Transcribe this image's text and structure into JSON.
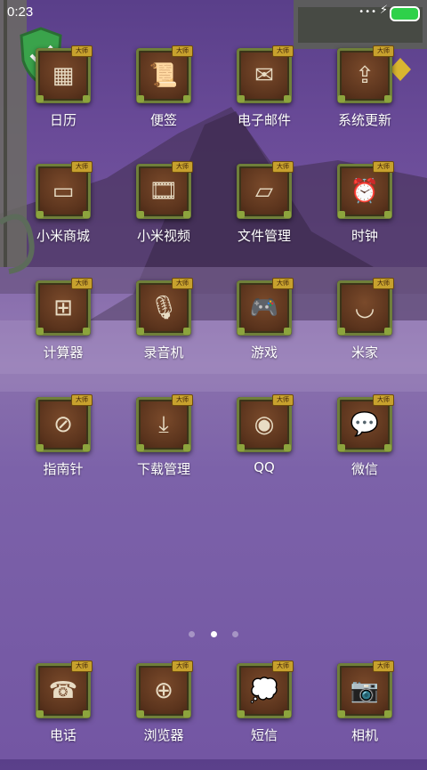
{
  "status_bar": {
    "time": "0:23",
    "signal": "•••"
  },
  "apps": [
    {
      "label": "日历",
      "glyph": "▦"
    },
    {
      "label": "便签",
      "glyph": "📜"
    },
    {
      "label": "电子邮件",
      "glyph": "✉"
    },
    {
      "label": "系统更新",
      "glyph": "⇪"
    },
    {
      "label": "小米商城",
      "glyph": "▭"
    },
    {
      "label": "小米视频",
      "glyph": "🎞"
    },
    {
      "label": "文件管理",
      "glyph": "▱"
    },
    {
      "label": "时钟",
      "glyph": "⏰"
    },
    {
      "label": "计算器",
      "glyph": "⊞"
    },
    {
      "label": "录音机",
      "glyph": "🎙"
    },
    {
      "label": "游戏",
      "glyph": "🎮"
    },
    {
      "label": "米家",
      "glyph": "◡"
    },
    {
      "label": "指南针",
      "glyph": "⊘"
    },
    {
      "label": "下载管理",
      "glyph": "⤓"
    },
    {
      "label": "QQ",
      "glyph": "◉"
    },
    {
      "label": "微信",
      "glyph": "💬"
    }
  ],
  "dock": [
    {
      "label": "电话",
      "glyph": "☎"
    },
    {
      "label": "浏览器",
      "glyph": "⊕"
    },
    {
      "label": "短信",
      "glyph": "💭"
    },
    {
      "label": "相机",
      "glyph": "📷"
    }
  ],
  "badge_text": "大师",
  "page_indicator": {
    "count": 3,
    "active": 1
  }
}
